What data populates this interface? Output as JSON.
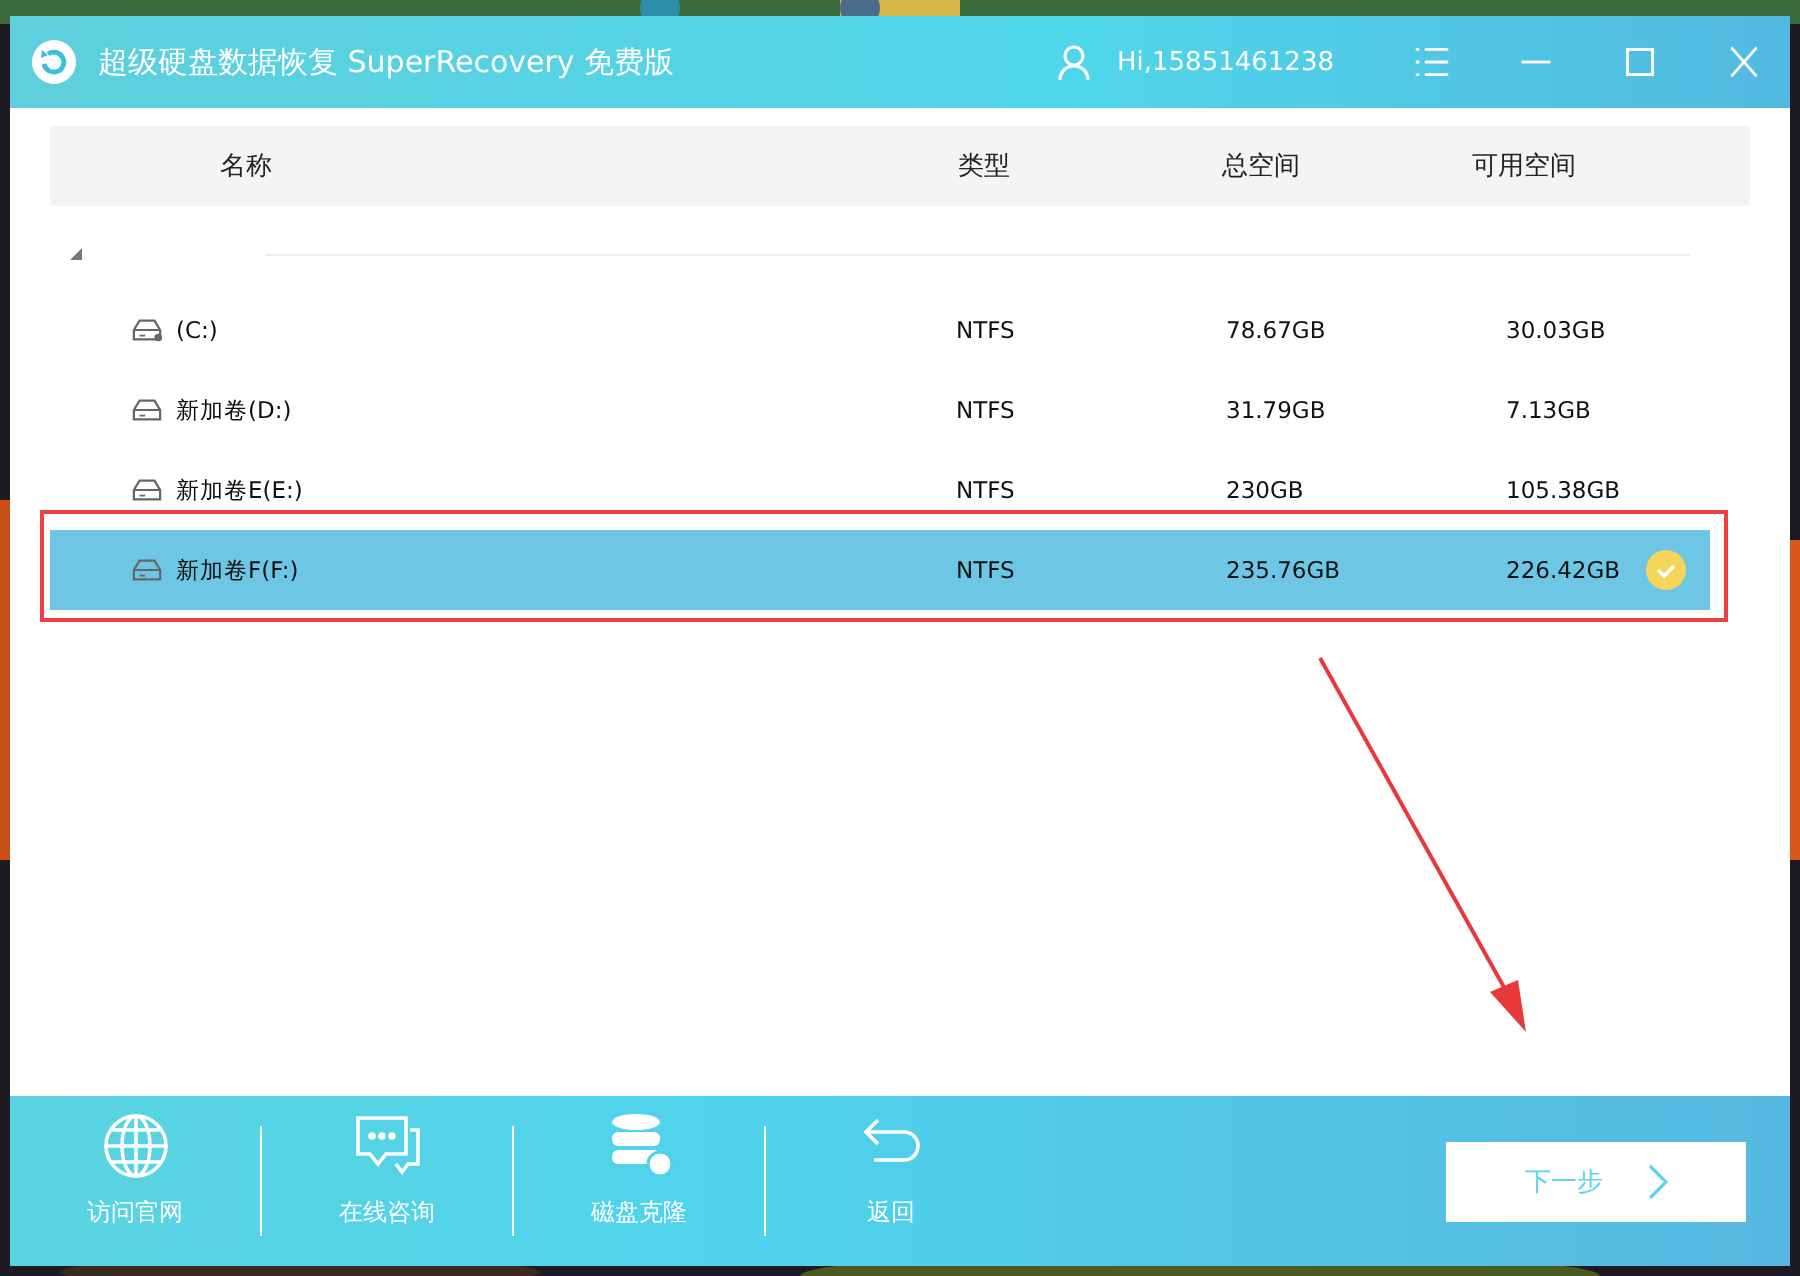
{
  "window": {
    "title": "超级硬盘数据恢复 SuperRecovery 免费版",
    "user": "Hi,15851461238"
  },
  "table": {
    "columns": [
      "名称",
      "类型",
      "总空间",
      "可用空间"
    ],
    "rows": [
      {
        "name": "(C:)",
        "kind": "system",
        "type": "NTFS",
        "total": "78.67GB",
        "free": "30.03GB",
        "selected": false
      },
      {
        "name": "新加卷(D:)",
        "kind": "drive",
        "type": "NTFS",
        "total": "31.79GB",
        "free": "7.13GB",
        "selected": false
      },
      {
        "name": "新加卷E(E:)",
        "kind": "drive",
        "type": "NTFS",
        "total": "230GB",
        "free": "105.38GB",
        "selected": false
      },
      {
        "name": "新加卷F(F:)",
        "kind": "drive",
        "type": "NTFS",
        "total": "235.76GB",
        "free": "226.42GB",
        "selected": true
      }
    ]
  },
  "footer": {
    "actions": [
      {
        "label": "访问官网",
        "kind": "globe"
      },
      {
        "label": "在线咨询",
        "kind": "chat"
      },
      {
        "label": "磁盘克隆",
        "kind": "database"
      },
      {
        "label": "返回",
        "kind": "back"
      }
    ],
    "next": "下一步"
  }
}
